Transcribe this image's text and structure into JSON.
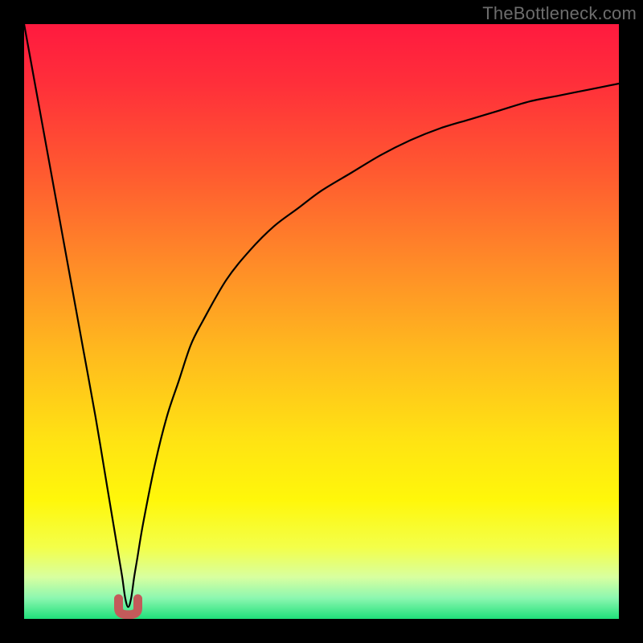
{
  "watermark": "TheBottleneck.com",
  "chart_data": {
    "type": "line",
    "title": "",
    "xlabel": "",
    "ylabel": "",
    "xlim": [
      0,
      100
    ],
    "ylim": [
      0,
      100
    ],
    "grid": false,
    "curve": {
      "comment": "Black curve: approximate absolute-deviation style dip reaching 0 near x≈17.5 then rising asymptotically; values estimated from pixels.",
      "x": [
        0,
        2,
        4,
        6,
        8,
        10,
        12,
        14,
        15,
        16,
        16.5,
        17,
        17.5,
        18,
        18.5,
        19,
        20,
        22,
        24,
        26,
        28,
        30,
        34,
        38,
        42,
        46,
        50,
        55,
        60,
        65,
        70,
        75,
        80,
        85,
        90,
        95,
        100
      ],
      "y": [
        100,
        89,
        78,
        67,
        56,
        45,
        34,
        22,
        16,
        10,
        7,
        3.5,
        2,
        3.5,
        7,
        10,
        16,
        26,
        34,
        40,
        46,
        50,
        57,
        62,
        66,
        69,
        72,
        75,
        78,
        80.5,
        82.5,
        84,
        85.5,
        87,
        88,
        89,
        90
      ]
    },
    "marker": {
      "comment": "Small red U-shaped marker at the curve minimum",
      "x": 17.5,
      "y": 1.5,
      "color": "#c35a5a"
    },
    "background_gradient": {
      "stops": [
        {
          "pos": 0.0,
          "color": "#ff1a3f"
        },
        {
          "pos": 0.1,
          "color": "#ff2f3a"
        },
        {
          "pos": 0.25,
          "color": "#ff5a30"
        },
        {
          "pos": 0.4,
          "color": "#ff8a28"
        },
        {
          "pos": 0.55,
          "color": "#ffb91e"
        },
        {
          "pos": 0.7,
          "color": "#ffe313"
        },
        {
          "pos": 0.8,
          "color": "#fff70a"
        },
        {
          "pos": 0.88,
          "color": "#f3ff4a"
        },
        {
          "pos": 0.93,
          "color": "#d8ffa0"
        },
        {
          "pos": 0.965,
          "color": "#8cf7b0"
        },
        {
          "pos": 1.0,
          "color": "#1fe07a"
        }
      ]
    }
  }
}
